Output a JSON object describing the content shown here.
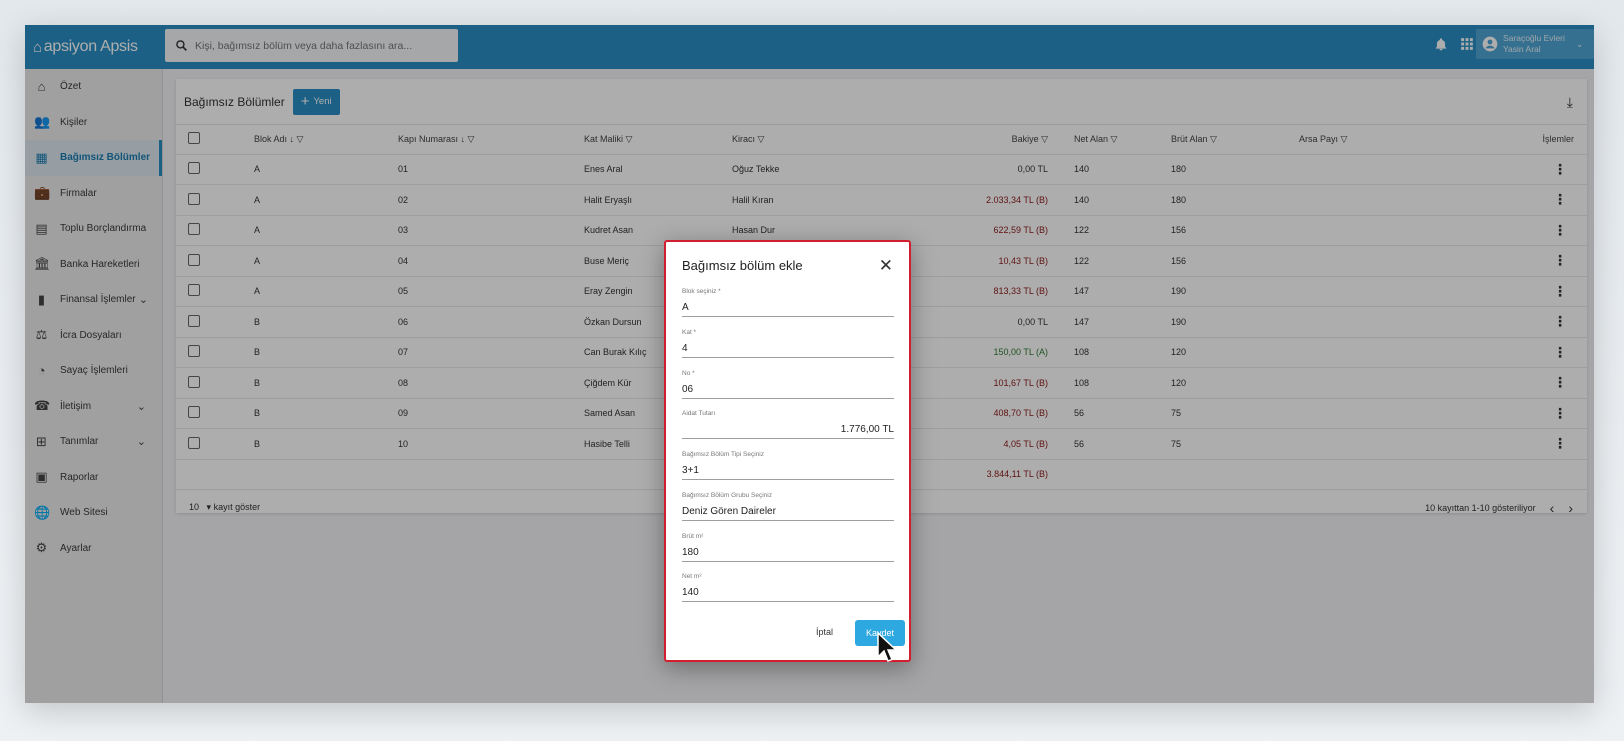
{
  "topbar": {
    "logo": "apsiyon Apsis",
    "search_placeholder": "Kişi, bağımsız bölüm veya daha fazlasını ara...",
    "account_line1": "Saraçoğlu Evleri",
    "account_line2": "Yasin Aral"
  },
  "sidebar": {
    "items": [
      {
        "label": "Özet",
        "icon": "home-icon"
      },
      {
        "label": "Kişiler",
        "icon": "people-icon"
      },
      {
        "label": "Bağımsız Bölümler",
        "icon": "building-icon"
      },
      {
        "label": "Firmalar",
        "icon": "briefcase-icon"
      },
      {
        "label": "Toplu Borçlandırma",
        "icon": "receipt-icon"
      },
      {
        "label": "Banka Hareketleri",
        "icon": "bank-icon"
      },
      {
        "label": "Finansal İşlemler",
        "icon": "bar-chart-icon"
      },
      {
        "label": "İcra Dosyaları",
        "icon": "gavel-icon"
      },
      {
        "label": "Sayaç İşlemleri",
        "icon": "meter-icon"
      },
      {
        "label": "İletişim",
        "icon": "phone-icon"
      },
      {
        "label": "Tanımlar",
        "icon": "add-box-icon"
      },
      {
        "label": "Raporlar",
        "icon": "report-icon"
      },
      {
        "label": "Web Sitesi",
        "icon": "globe-icon"
      },
      {
        "label": "Ayarlar",
        "icon": "gear-icon"
      }
    ]
  },
  "card": {
    "title": "Bağımsız Bölümler",
    "new_label": "Yeni"
  },
  "table": {
    "headers": [
      "Blok Adı",
      "Kapı Numarası",
      "Kat Maliki",
      "Kiracı",
      "Bakiye",
      "Net Alan",
      "Brüt Alan",
      "Arsa Payı",
      "İşlemler"
    ],
    "rows": [
      {
        "blok": "A",
        "kapi": "01",
        "malik": "Enes Aral",
        "kiraci": "Oğuz Tekke",
        "bakiye": "0,00 TL",
        "tone": "",
        "net": "140",
        "brut": "180"
      },
      {
        "blok": "A",
        "kapi": "02",
        "malik": "Halit Eryaşlı",
        "kiraci": "Halil Kıran",
        "bakiye": "2.033,34 TL (B)",
        "tone": "red",
        "net": "140",
        "brut": "180"
      },
      {
        "blok": "A",
        "kapi": "03",
        "malik": "Kudret Asan",
        "kiraci": "Hasan Dur",
        "bakiye": "622,59 TL (B)",
        "tone": "red",
        "net": "122",
        "brut": "156"
      },
      {
        "blok": "A",
        "kapi": "04",
        "malik": "Buse Meriç",
        "kiraci": "",
        "bakiye": "10,43 TL (B)",
        "tone": "red",
        "net": "122",
        "brut": "156"
      },
      {
        "blok": "A",
        "kapi": "05",
        "malik": "Eray Zengin",
        "kiraci": "",
        "bakiye": "813,33 TL (B)",
        "tone": "red",
        "net": "147",
        "brut": "190"
      },
      {
        "blok": "B",
        "kapi": "06",
        "malik": "Özkan Dursun",
        "kiraci": "",
        "bakiye": "0,00 TL",
        "tone": "",
        "net": "147",
        "brut": "190"
      },
      {
        "blok": "B",
        "kapi": "07",
        "malik": "Can Burak Kılıç",
        "kiraci": "",
        "bakiye": "150,00 TL (A)",
        "tone": "green",
        "net": "108",
        "brut": "120"
      },
      {
        "blok": "B",
        "kapi": "08",
        "malik": "Çiğdem Kür",
        "kiraci": "",
        "bakiye": "101,67 TL (B)",
        "tone": "red",
        "net": "108",
        "brut": "120"
      },
      {
        "blok": "B",
        "kapi": "09",
        "malik": "Samed Asan",
        "kiraci": "",
        "bakiye": "408,70 TL (B)",
        "tone": "red",
        "net": "56",
        "brut": "75"
      },
      {
        "blok": "B",
        "kapi": "10",
        "malik": "Hasibe Telli",
        "kiraci": "",
        "bakiye": "4,05 TL (B)",
        "tone": "red",
        "net": "56",
        "brut": "75"
      }
    ],
    "total": "3.844,11 TL (B)"
  },
  "footer": {
    "page_size": "10",
    "page_size_label": "kayıt göster",
    "range_text": "10 kayıttan 1-10 gösteriliyor"
  },
  "dialog": {
    "title": "Bağımsız bölüm ekle",
    "fields": [
      {
        "label": "Blok seçiniz *",
        "value": "A",
        "align": "left"
      },
      {
        "label": "Kat *",
        "value": "4",
        "align": "left"
      },
      {
        "label": "No *",
        "value": "06",
        "align": "left"
      },
      {
        "label": "Aidat Tutarı",
        "value": "1.776,00 TL",
        "align": "right"
      },
      {
        "label": "Bağımsız Bölüm Tipi Seçiniz",
        "value": "3+1",
        "align": "left"
      },
      {
        "label": "Bağımsız Bölüm Grubu Seçiniz",
        "value": "Deniz Gören Daireler",
        "align": "left"
      },
      {
        "label": "Brüt m²",
        "value": "180",
        "align": "left"
      },
      {
        "label": "Net m²",
        "value": "140",
        "align": "left"
      }
    ],
    "cancel_label": "İptal",
    "save_label": "Kaydet"
  },
  "colors": {
    "primary": "#2a8fc4",
    "dialog_border": "#d21f2f",
    "debt": "#8b1a1a",
    "credit": "#2e7d32"
  }
}
